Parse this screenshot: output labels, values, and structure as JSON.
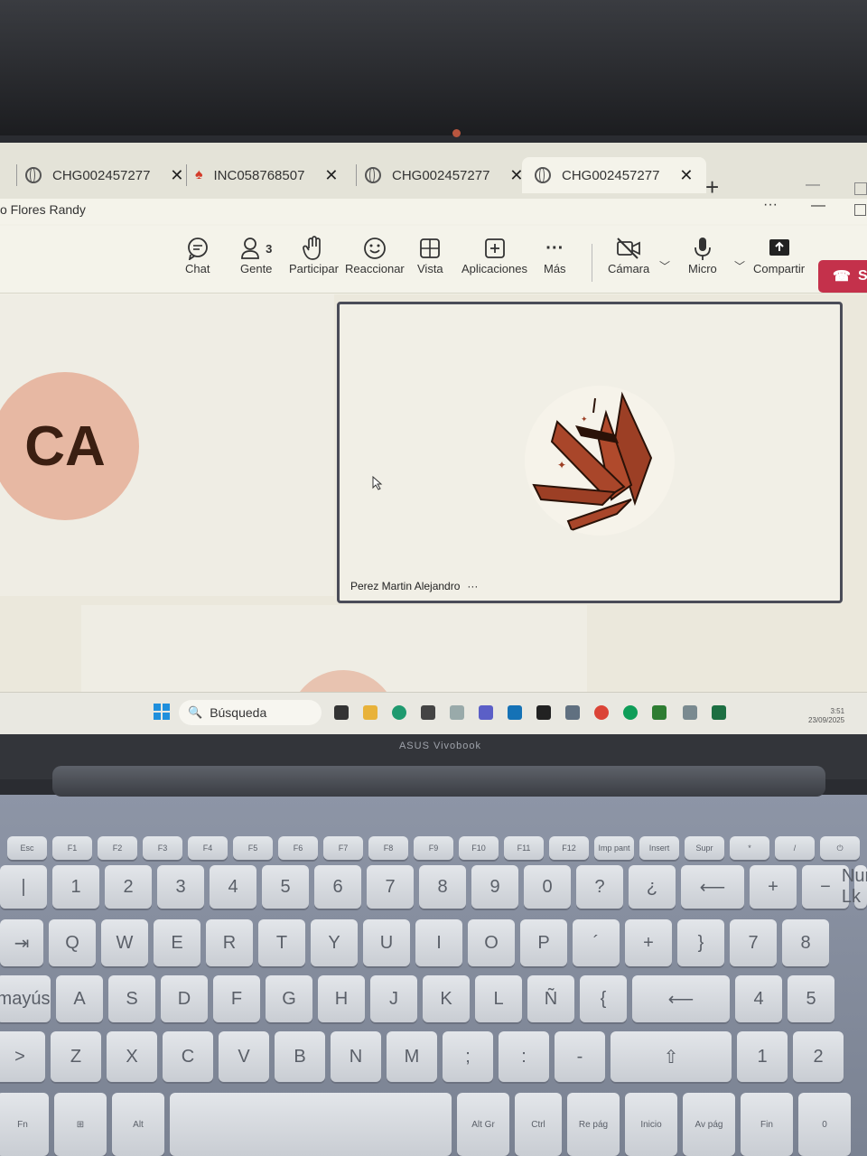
{
  "browser": {
    "tabs": [
      {
        "label": "CHG002457277",
        "icon": "globe-icon"
      },
      {
        "label": "INC058768507",
        "icon": "flame-icon"
      },
      {
        "label": "CHG002457277",
        "icon": "globe-icon"
      },
      {
        "label": "CHG002457277",
        "icon": "globe-icon",
        "active": true
      }
    ],
    "new_tab": "+",
    "close_glyph": "✕"
  },
  "window": {
    "user_name": "o Flores Randy",
    "more": "···"
  },
  "toolbar": {
    "chat": "Chat",
    "people": "Gente",
    "people_count": "3",
    "raise": "Participar",
    "react": "Reaccionar",
    "view": "Vista",
    "apps": "Aplicaciones",
    "more": "Más",
    "camera": "Cámara",
    "mic": "Micro",
    "share": "Compartir",
    "leave": "S"
  },
  "stage": {
    "left_avatar": "CA",
    "main_participant": "Perez Martin Alejandro",
    "participant_more": "···"
  },
  "taskbar": {
    "search": "Búsqueda",
    "time": "3:51",
    "date": "23/09/2025"
  },
  "laptop": {
    "brand": "ASUS Vivobook"
  },
  "colors": {
    "leave_red": "#c4314b",
    "avatar_peach": "#e7b8a3",
    "logo_rust": "#9c3f25"
  },
  "keyboard": {
    "row_fn": [
      "Esc",
      "F1",
      "F2",
      "F3",
      "F4",
      "F5",
      "F6",
      "F7",
      "F8",
      "F9",
      "F10",
      "F11",
      "F12",
      "Imp pant",
      "Insert",
      "Supr",
      "*",
      "/",
      "⏻"
    ],
    "row_num": [
      "|",
      "1",
      "2",
      "3",
      "4",
      "5",
      "6",
      "7",
      "8",
      "9",
      "0",
      "?",
      "¿",
      "⟵",
      "+",
      "−",
      "Num Lk"
    ],
    "row_q": [
      "⇥",
      "Q",
      "W",
      "E",
      "R",
      "T",
      "Y",
      "U",
      "I",
      "O",
      "P",
      "´",
      "+",
      "}",
      "7",
      "8"
    ],
    "row_a": [
      "mayús",
      "A",
      "S",
      "D",
      "F",
      "G",
      "H",
      "J",
      "K",
      "L",
      "Ñ",
      "{",
      "⟵",
      "4",
      "5"
    ],
    "row_z": [
      ">",
      "Z",
      "X",
      "C",
      "V",
      "B",
      "N",
      "M",
      ";",
      ":",
      "-",
      "⇧",
      "1",
      "2"
    ],
    "row_space": [
      "Fn",
      "⊞",
      "Alt",
      "",
      "Alt Gr",
      "Ctrl",
      "Re pág",
      "Inicio",
      "Av pág",
      "Fin",
      "0"
    ]
  }
}
